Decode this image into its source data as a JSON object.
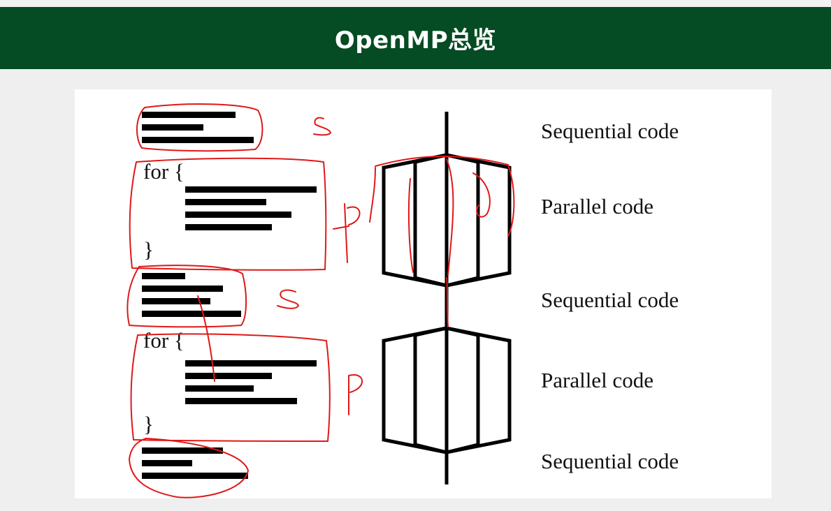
{
  "slide": {
    "title": "OpenMP总览"
  },
  "diagram": {
    "code_keywords": {
      "loop_1": "for {",
      "loop_1_close": "}",
      "loop_2": "for {",
      "loop_2_close": "}"
    },
    "labels": [
      "Sequential code",
      "Parallel code",
      "Sequential code",
      "Parallel code",
      "Sequential code"
    ]
  },
  "colors": {
    "header_bg": "#054b23",
    "annotation_red": "#e01818",
    "ink": "#000000"
  }
}
